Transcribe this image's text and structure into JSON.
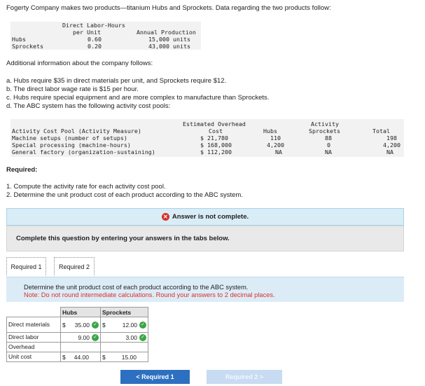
{
  "intro": "Fogerty Company makes two products—titanium Hubs and Sprockets. Data regarding the two products follow:",
  "product_table": {
    "header_col1": "Direct Labor-Hours",
    "header_col1b": "per Unit",
    "header_col2": "Annual Production",
    "rows": [
      {
        "name": "Hubs",
        "dlh": "0.60",
        "prod": "15,000 units"
      },
      {
        "name": "Sprockets",
        "dlh": "0.20",
        "prod": "43,000 units"
      }
    ]
  },
  "additional": "Additional information about the company follows:",
  "items": [
    "a. Hubs require $35 in direct materials per unit, and Sprockets require $12.",
    "b. The direct labor wage rate is $15 per hour.",
    "c. Hubs require special equipment and are more complex to manufacture than Sprockets.",
    "d. The ABC system has the following activity cost pools:"
  ],
  "abc_table": {
    "h_overhead1": "Estimated Overhead",
    "h_overhead2": "Cost",
    "h_activity1": "Activity",
    "h_pool": "Activity Cost Pool (Activity Measure)",
    "h_hubs": "Hubs",
    "h_sprockets": "Sprockets",
    "h_total": "Total",
    "rows": [
      {
        "pool": "Machine setups (number of setups)",
        "cost": "$ 21,780",
        "hubs": "110",
        "sprockets": "88",
        "total": "198"
      },
      {
        "pool": "Special processing (machine-hours)",
        "cost": "$ 168,000",
        "hubs": "4,200",
        "sprockets": "0",
        "total": "4,200"
      },
      {
        "pool": "General factory (organization-sustaining)",
        "cost": "$ 112,200",
        "hubs": "NA",
        "sprockets": "NA",
        "total": "NA"
      }
    ]
  },
  "required_title": "Required:",
  "required_items": [
    "1. Compute the activity rate for each activity cost pool.",
    "2. Determine the unit product cost of each product according to the ABC system."
  ],
  "banner": "Answer is not complete.",
  "instruction": "Complete this question by entering your answers in the tabs below.",
  "tabs": [
    "Required 1",
    "Required 2"
  ],
  "panel_line1": "Determine the unit product cost of each product according to the ABC system.",
  "panel_line2": "Note: Do not round intermediate calculations. Round your answers to 2 decimal places.",
  "answer_table": {
    "h_hubs": "Hubs",
    "h_sprockets": "Sprockets",
    "rows": [
      {
        "label": "Direct materials",
        "hubs_cur": "$",
        "hubs": "35.00",
        "hubs_ok": true,
        "spr_cur": "$",
        "spr": "12.00",
        "spr_ok": true
      },
      {
        "label": "Direct labor",
        "hubs_cur": "",
        "hubs": "9.00",
        "hubs_ok": true,
        "spr_cur": "",
        "spr": "3.00",
        "spr_ok": true
      },
      {
        "label": "Overhead",
        "hubs_cur": "",
        "hubs": "",
        "hubs_ok": false,
        "spr_cur": "",
        "spr": "",
        "spr_ok": false
      },
      {
        "label": "Unit cost",
        "hubs_cur": "$",
        "hubs": "44.00",
        "hubs_ok": false,
        "spr_cur": "$",
        "spr": "15.00",
        "spr_ok": false
      }
    ]
  },
  "buttons": {
    "prev": "< Required 1",
    "next": "Required 2 >"
  },
  "colors": {
    "accent": "#2d6fc0",
    "check": "#3aa547",
    "error": "#d9302a"
  }
}
